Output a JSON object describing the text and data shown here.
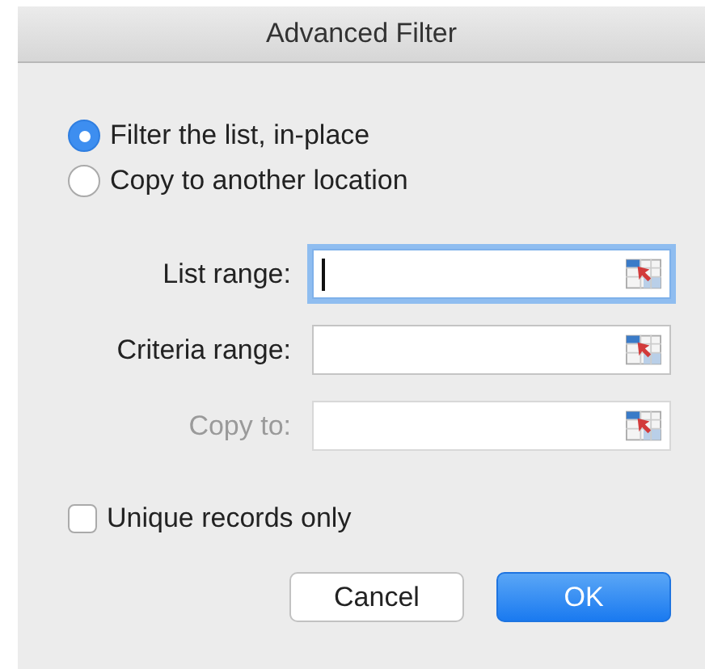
{
  "window": {
    "title": "Advanced Filter"
  },
  "action": [
    {
      "label": "Filter the list, in-place",
      "selected": true
    },
    {
      "label": "Copy to another location",
      "selected": false
    }
  ],
  "fields": [
    {
      "label": "List range:",
      "focused": true,
      "disabled": false
    },
    {
      "label": "Criteria range:",
      "focused": false,
      "disabled": false
    },
    {
      "label": "Copy to:",
      "focused": false,
      "disabled": true
    }
  ],
  "unique_records": {
    "label": "Unique records only",
    "checked": false
  },
  "buttons": [
    {
      "label": "Cancel",
      "kind": "normal"
    },
    {
      "label": "OK",
      "kind": "default"
    }
  ]
}
